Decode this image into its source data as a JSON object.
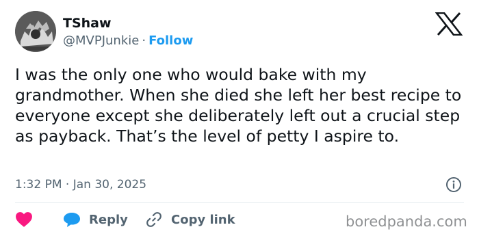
{
  "author": {
    "name": "TShaw",
    "handle": "@MVPJunkie",
    "separator": "·",
    "follow_label": "Follow"
  },
  "tweet": {
    "text": "I was the only one who would bake with my grandmother. When she died she left her best recipe to everyone except she deliberately left out a crucial step as payback. That’s the level of petty I aspire to.",
    "timestamp": "1:32 PM · Jan 30, 2025"
  },
  "actions": {
    "reply_label": "Reply",
    "copy_link_label": "Copy link"
  },
  "icons": {
    "like": "heart-icon",
    "reply": "speech-bubble-icon",
    "copy": "link-icon",
    "info": "info-icon",
    "brand": "x-logo-icon"
  },
  "colors": {
    "accent": "#1d9bf0",
    "like": "#f91880",
    "text": "#0f1419",
    "muted": "#536471"
  },
  "watermark": "boredpanda.com"
}
